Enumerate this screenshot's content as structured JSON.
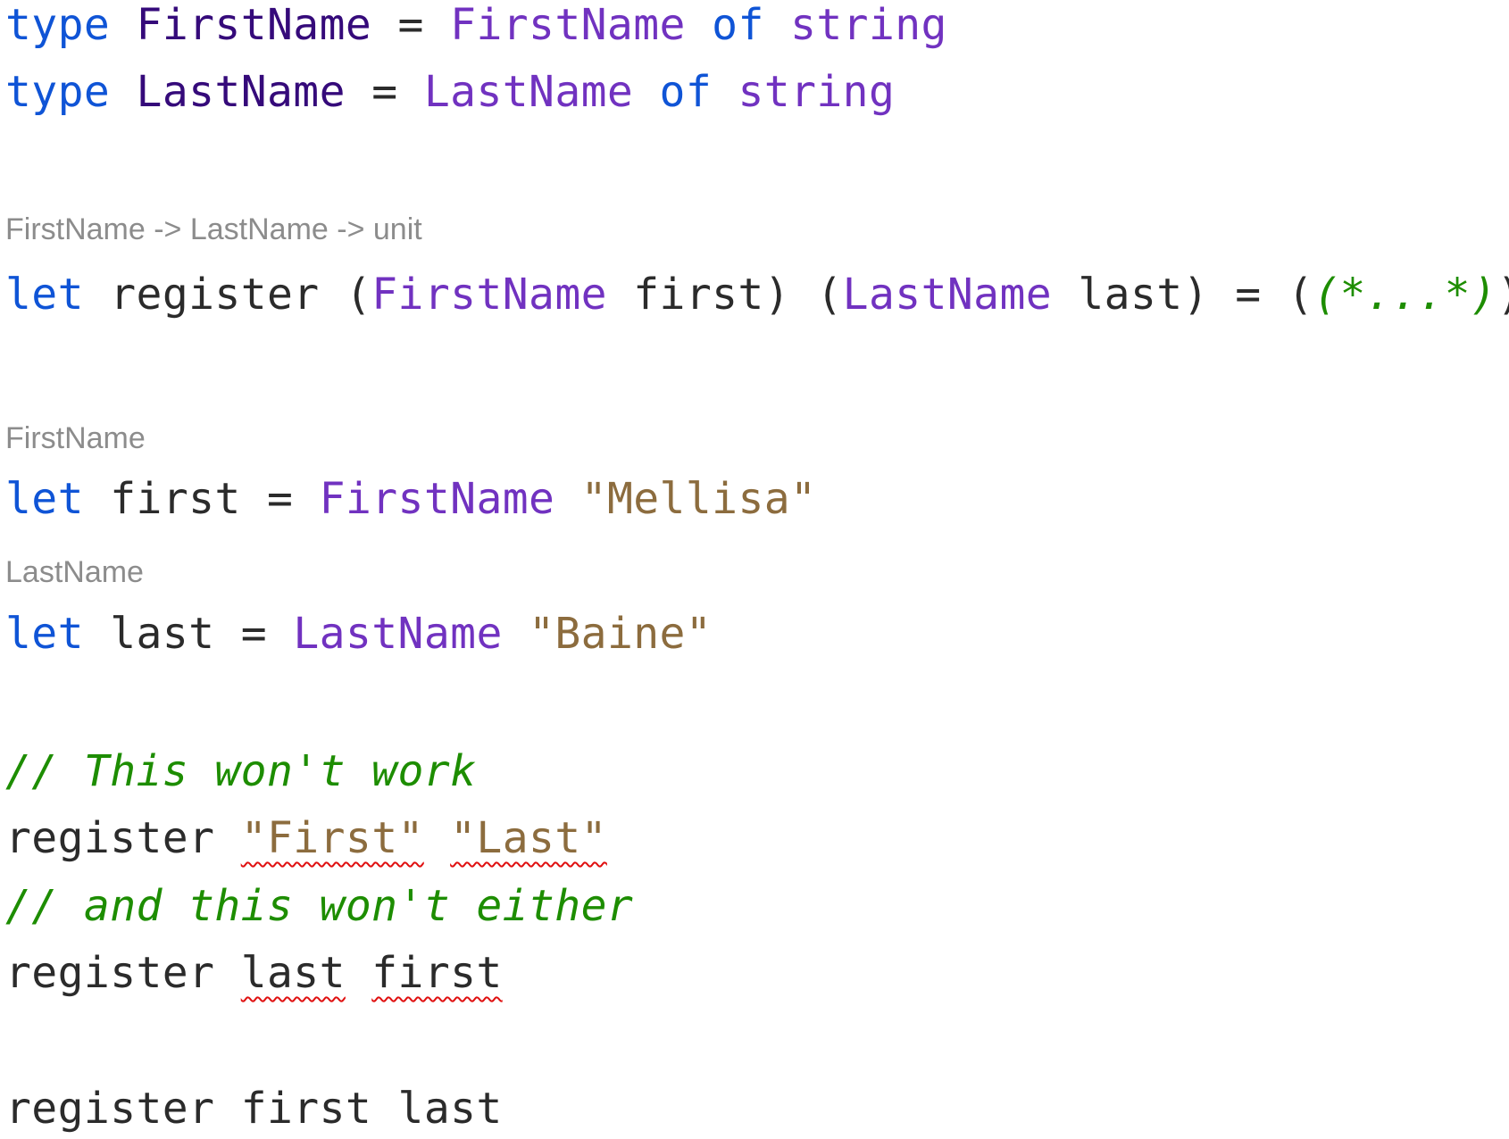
{
  "editor": {
    "lines": {
      "l1": {
        "kw": "type",
        "name": "FirstName",
        "eq": "=",
        "case": "FirstName",
        "of": "of",
        "type": "string"
      },
      "l2": {
        "kw": "type",
        "name": "LastName",
        "eq": "=",
        "case": "LastName",
        "of": "of",
        "type": "string"
      },
      "hint_register": "FirstName -> LastName -> unit",
      "l3": {
        "kw": "let",
        "fn": "register",
        "p1_open": "(",
        "p1_case": "FirstName",
        "p1_name": "first",
        "p1_close": ")",
        "p2_open": "(",
        "p2_case": "LastName",
        "p2_name": "last",
        "p2_close": ")",
        "eq": "=",
        "body_open": "(",
        "body_comment": "(*...*)",
        "body_close": ")"
      },
      "hint_first": "FirstName",
      "l4": {
        "kw": "let",
        "name": "first",
        "eq": "=",
        "case": "FirstName",
        "value": "\"Mellisa\""
      },
      "hint_last": "LastName",
      "l5": {
        "kw": "let",
        "name": "last",
        "eq": "=",
        "case": "LastName",
        "value": "\"Baine\""
      },
      "c1": "// This won't work",
      "l6": {
        "fn": "register",
        "arg1": "\"First\"",
        "arg2": "\"Last\""
      },
      "c2": "// and this won't either",
      "l7": {
        "fn": "register",
        "arg1": "last",
        "arg2": "first"
      },
      "l8": {
        "fn": "register",
        "arg1": "first",
        "arg2": "last"
      }
    },
    "colors": {
      "keyword": "#0f54d6",
      "type_name": "#350a7a",
      "union_case": "#7132c0",
      "identifier": "#2b2b2b",
      "string": "#8c6c3e",
      "comment": "#1d8d00",
      "inlay_hint": "#8c8c8c",
      "error_squiggle": "#e01010"
    }
  }
}
